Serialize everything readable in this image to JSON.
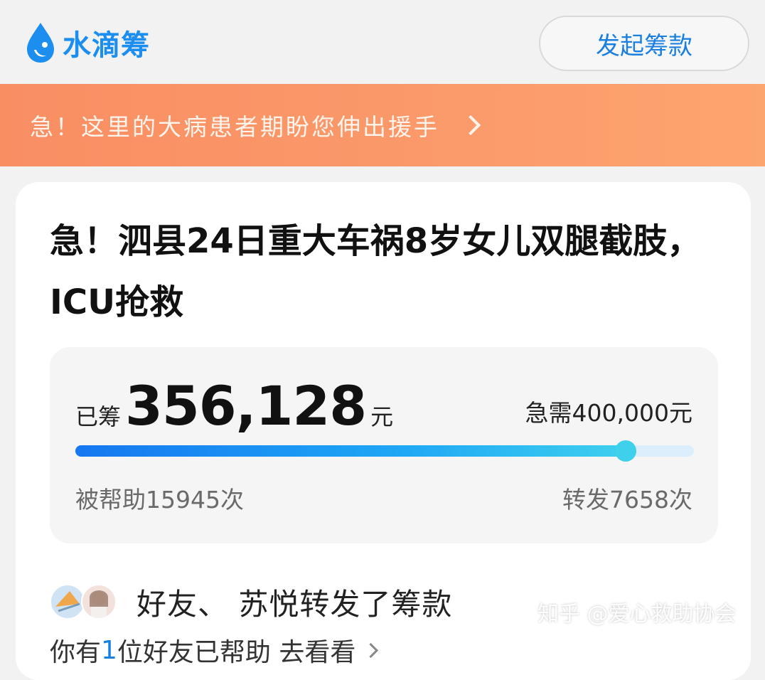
{
  "header": {
    "logo_text": "水滴筹",
    "logo_icon": "water-drop-icon",
    "start_button_label": "发起筹款"
  },
  "banner": {
    "text": "急！这里的大病患者期盼您伸出援手",
    "chevron_icon": "chevron-right-icon"
  },
  "campaign": {
    "title": "急！泗县24日重大车祸8岁女儿双腿截肢，ICU抢救",
    "raised_label": "已筹",
    "raised_amount": "356,128",
    "raised_unit": "元",
    "target_text": "急需400,000元",
    "progress": 0.89,
    "helped_text": "被帮助15945次",
    "shares_text": "转发7658次"
  },
  "friends": {
    "share_text": "好友、 苏悦转发了筹款",
    "next_line_prefix": "你有",
    "next_line_count": "1",
    "next_line_suffix": "位好友已帮助 去看看"
  },
  "watermark": "知乎 @爱心救助协会",
  "colors": {
    "brand_blue": "#1b8ef0",
    "banner_orange": "#fb9a6b",
    "progress_blue": "#1677f0",
    "progress_cyan": "#3ed0ee"
  }
}
